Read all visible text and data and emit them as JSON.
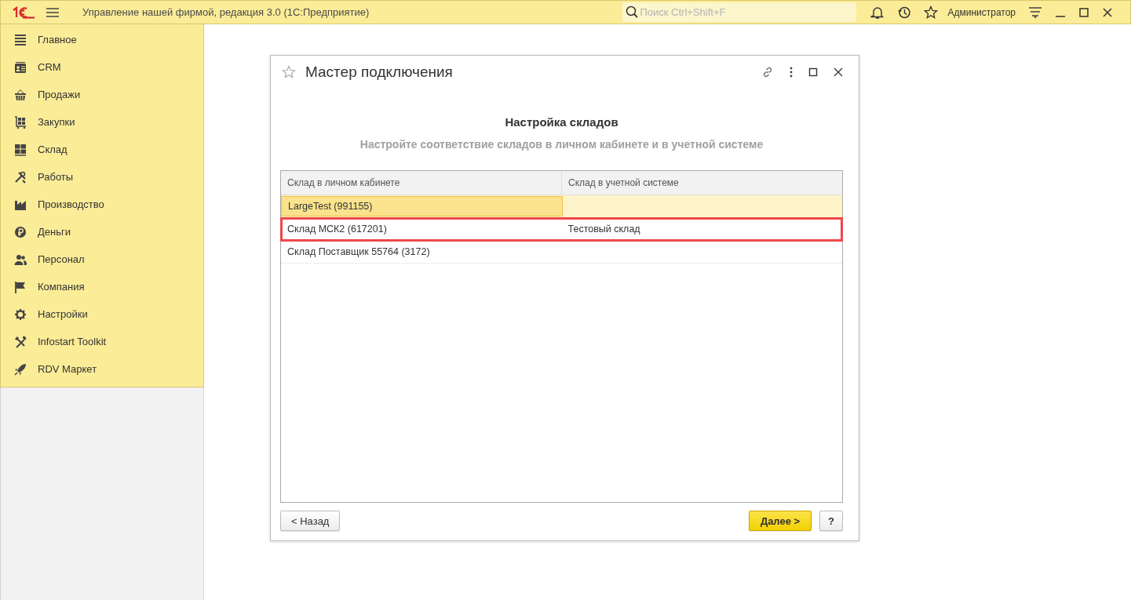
{
  "app_bar": {
    "title": "Управление нашей фирмой, редакция 3.0  (1С:Предприятие)",
    "search": {
      "placeholder": "Поиск Ctrl+Shift+F"
    },
    "user": "Администратор"
  },
  "sidebar": {
    "items": [
      {
        "label": "Главное"
      },
      {
        "label": "CRM"
      },
      {
        "label": "Продажи"
      },
      {
        "label": "Закупки"
      },
      {
        "label": "Склад"
      },
      {
        "label": "Работы"
      },
      {
        "label": "Производство"
      },
      {
        "label": "Деньги"
      },
      {
        "label": "Персонал"
      },
      {
        "label": "Компания"
      },
      {
        "label": "Настройки"
      },
      {
        "label": "Infostart Toolkit"
      },
      {
        "label": "RDV Маркет"
      }
    ]
  },
  "dialog": {
    "title": "Мастер подключения",
    "heading": "Настройка складов",
    "subheading": "Настройте соответствие складов в личном кабинете и в учетной системе",
    "table": {
      "columns": [
        "Склад в личном кабинете",
        "Склад в учетной системе"
      ],
      "rows": [
        {
          "cells": [
            "LargeTest (991155)",
            ""
          ],
          "selected": true,
          "highlighted": false
        },
        {
          "cells": [
            "Склад МСК2 (617201)",
            "Тестовый склад"
          ],
          "selected": false,
          "highlighted": true
        },
        {
          "cells": [
            "Склад Поставщик 55764 (3172)",
            ""
          ],
          "selected": false,
          "highlighted": false
        }
      ]
    },
    "back_button": "< Назад",
    "next_button": "Далее >",
    "help_button": "?"
  }
}
